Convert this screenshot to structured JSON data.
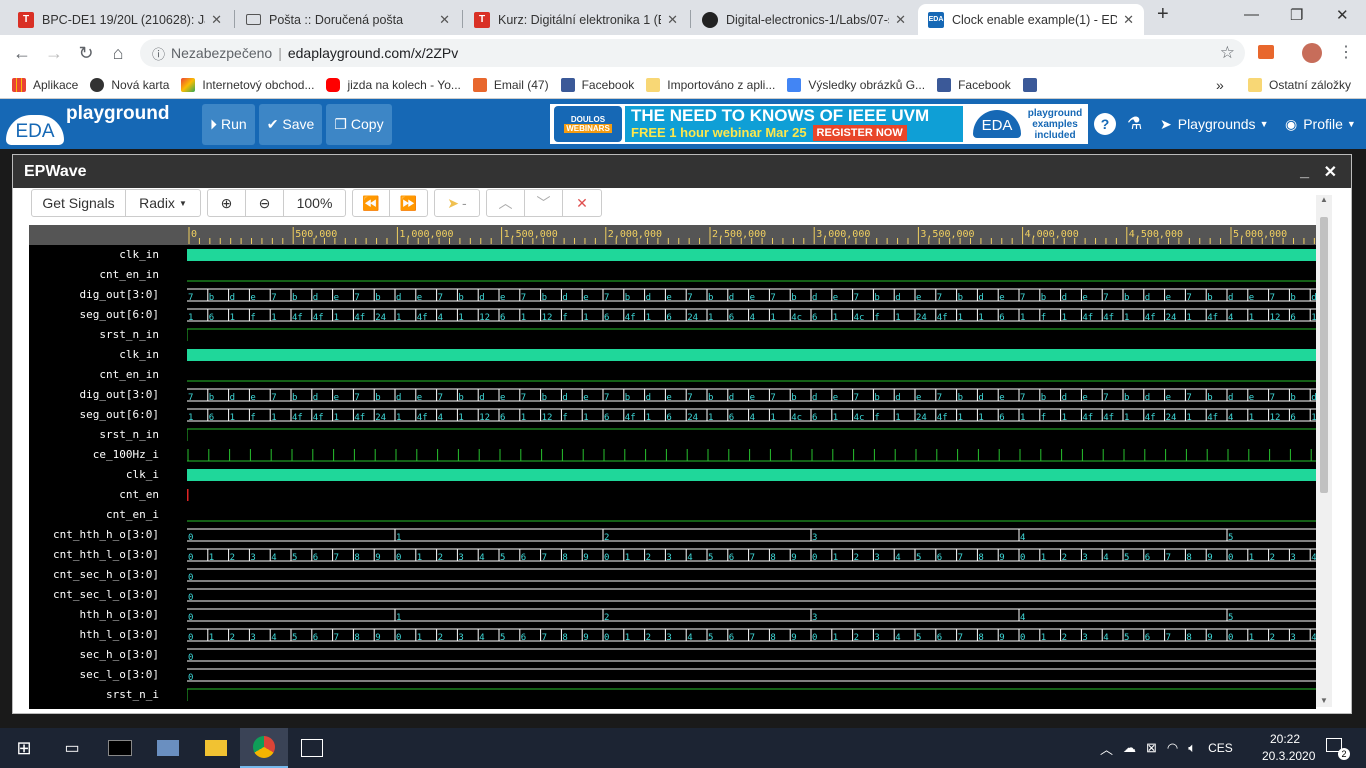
{
  "browser": {
    "tabs": [
      {
        "title": "BPC-DE1 19/20L (210628): Jak",
        "icon": "t-icon",
        "color": "#d93025"
      },
      {
        "title": "Pošta :: Doručená pošta",
        "icon": "mail-icon",
        "color": "#555"
      },
      {
        "title": "Kurz: Digitální elektronika 1 (BI",
        "icon": "t-icon",
        "color": "#d93025"
      },
      {
        "title": "Digital-electronics-1/Labs/07-s",
        "icon": "github-icon",
        "color": "#222"
      },
      {
        "title": "Clock enable example(1) - EDA",
        "icon": "eda-icon",
        "color": "#1668b5"
      }
    ],
    "security": "Nezabezpečeno",
    "url": "edaplayground.com/x/2ZPv",
    "bookmarks": [
      "Aplikace",
      "Nová karta",
      "Internetový obchod...",
      "jizda na kolech - Yo...",
      "Email (47)",
      "Facebook",
      "Importováno z apli...",
      "Výsledky obrázků G...",
      "Facebook"
    ],
    "other_bookmarks": "Ostatní záložky"
  },
  "eda": {
    "logo": "EDA",
    "logo_sub": "playground",
    "buttons": {
      "run": "Run",
      "save": "Save",
      "copy": "Copy"
    },
    "banner": {
      "brand": "DOULOS",
      "brand_sub": "WEBINARS",
      "headline": "THE NEED TO KNOWS OF IEEE UVM",
      "sub": "FREE 1 hour webinar Mar 25",
      "cta": "REGISTER NOW",
      "right_logo": "EDA",
      "right_text": "playground examples included"
    },
    "menu": {
      "playgrounds": "Playgrounds",
      "profile": "Profile"
    }
  },
  "epwave": {
    "title": "EPWave",
    "toolbar": {
      "get_signals": "Get Signals",
      "radix": "Radix",
      "zoom": "100%",
      "cursor": "-"
    },
    "ruler_labels": [
      "0",
      "500,000",
      "1,000,000",
      "1,500,000",
      "2,000,000",
      "2,500,000",
      "3,000,000",
      "3,500,000",
      "4,000,000",
      "4,500,000",
      "5,000,000"
    ],
    "signals": [
      {
        "name": "clk_in",
        "type": "clock"
      },
      {
        "name": "cnt_en_in",
        "type": "low"
      },
      {
        "name": "dig_out[3:0]",
        "type": "bus",
        "cycle": [
          "7",
          "b",
          "d",
          "e"
        ],
        "period": 20.8
      },
      {
        "name": "seg_out[6:0]",
        "type": "bus",
        "values": [
          "1",
          "6",
          "1",
          "f",
          "1",
          "4f",
          "4f",
          "1",
          "4f",
          "24",
          "1",
          "4f",
          "4",
          "1",
          "12",
          "6",
          "1",
          "12",
          "f",
          "1",
          "6",
          "4f",
          "1",
          "6",
          "24",
          "1",
          "6",
          "4",
          "1",
          "4c",
          "6",
          "1",
          "4c",
          "f",
          "1",
          "24",
          "4f",
          "1"
        ],
        "period": 20.8
      },
      {
        "name": "srst_n_in",
        "type": "high"
      },
      {
        "name": "clk_in",
        "type": "clock"
      },
      {
        "name": "cnt_en_in",
        "type": "low"
      },
      {
        "name": "dig_out[3:0]",
        "type": "bus",
        "cycle": [
          "7",
          "b",
          "d",
          "e"
        ],
        "period": 20.8
      },
      {
        "name": "seg_out[6:0]",
        "type": "bus",
        "values": [
          "1",
          "6",
          "1",
          "f",
          "1",
          "4f",
          "4f",
          "1",
          "4f",
          "24",
          "1",
          "4f",
          "4",
          "1",
          "12",
          "6",
          "1",
          "12",
          "f",
          "1",
          "6",
          "4f",
          "1",
          "6",
          "24",
          "1",
          "6",
          "4",
          "1",
          "4c",
          "6",
          "1",
          "4c",
          "f",
          "1",
          "24",
          "4f",
          "1"
        ],
        "period": 20.8
      },
      {
        "name": "srst_n_in",
        "type": "high"
      },
      {
        "name": "ce_100Hz_i",
        "type": "pulse",
        "period": 20.8
      },
      {
        "name": "clk_i",
        "type": "clock"
      },
      {
        "name": "cnt_en",
        "type": "red"
      },
      {
        "name": "cnt_en_i",
        "type": "low"
      },
      {
        "name": "cnt_hth_h_o[3:0]",
        "type": "bus",
        "cycle": [
          "0",
          "1",
          "2",
          "3",
          "4",
          "5"
        ],
        "period": 208
      },
      {
        "name": "cnt_hth_l_o[3:0]",
        "type": "bus",
        "cycle": [
          "0",
          "1",
          "2",
          "3",
          "4",
          "5",
          "6",
          "7",
          "8",
          "9"
        ],
        "period": 20.8
      },
      {
        "name": "cnt_sec_h_o[3:0]",
        "type": "bus",
        "cycle": [
          "0"
        ],
        "period": 2000
      },
      {
        "name": "cnt_sec_l_o[3:0]",
        "type": "bus",
        "cycle": [
          "0"
        ],
        "period": 2000
      },
      {
        "name": "hth_h_o[3:0]",
        "type": "bus",
        "cycle": [
          "0",
          "1",
          "2",
          "3",
          "4",
          "5"
        ],
        "period": 208
      },
      {
        "name": "hth_l_o[3:0]",
        "type": "bus",
        "cycle": [
          "0",
          "1",
          "2",
          "3",
          "4",
          "5",
          "6",
          "7",
          "8",
          "9"
        ],
        "period": 20.8
      },
      {
        "name": "sec_h_o[3:0]",
        "type": "bus",
        "cycle": [
          "0"
        ],
        "period": 2000
      },
      {
        "name": "sec_l_o[3:0]",
        "type": "bus",
        "cycle": [
          "0"
        ],
        "period": 2000
      },
      {
        "name": "srst_n_i",
        "type": "high"
      }
    ],
    "colors": {
      "bus": "#3ed8d8",
      "clock": "#1fd79a",
      "high": "#27c12e",
      "red": "#e02424"
    }
  },
  "taskbar": {
    "lang": "CES",
    "time": "20:22",
    "date": "20.3.2020",
    "notifications": "2"
  }
}
